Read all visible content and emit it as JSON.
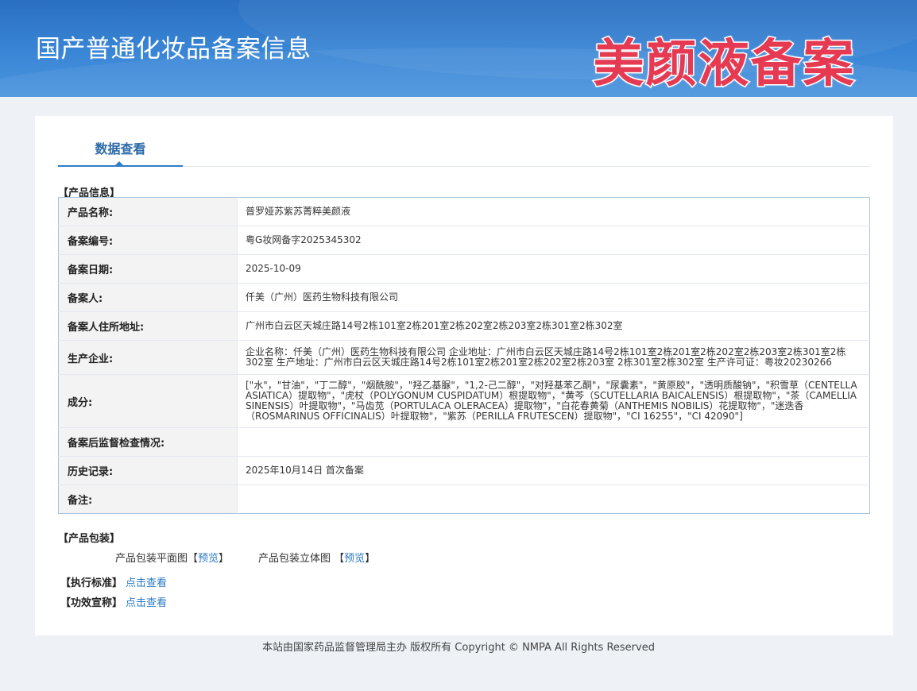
{
  "header": {
    "title": "国产普通化妆品备案信息",
    "overlay_text": "美颜液备案"
  },
  "tabs": [
    {
      "label": "数据查看",
      "active": true
    }
  ],
  "product_info": {
    "section_label": "【产品信息】",
    "rows": [
      {
        "label": "产品名称:",
        "value": "普罗娅苏紫苏菁粹美颜液"
      },
      {
        "label": "备案编号:",
        "value": "粤G妆网备字2025345302"
      },
      {
        "label": "备案日期:",
        "value": "2025-10-09"
      },
      {
        "label": "备案人:",
        "value": "仟美（广州）医药生物科技有限公司"
      },
      {
        "label": "备案人住所地址:",
        "value": "广州市白云区天城庄路14号2栋101室2栋201室2栋202室2栋203室2栋301室2栋302室"
      },
      {
        "label": "生产企业:",
        "value": "企业名称：仟美（广州）医药生物科技有限公司 企业地址：广州市白云区天城庄路14号2栋101室2栋201室2栋202室2栋203室2栋301室2栋302室 生产地址：广州市白云区天城庄路14号2栋101室2栋201室2栋202室2栋203室 2栋301室2栋302室 生产许可证：粤妆20230266"
      },
      {
        "label": "成分:",
        "value": "[\"水\"，\"甘油\"，\"丁二醇\"，\"烟酰胺\"，\"羟乙基脲\"，\"1,2-己二醇\"，\"对羟基苯乙酮\"，\"尿囊素\"，\"黄原胶\"，\"透明质酸钠\"，\"积雪草（CENTELLA ASIATICA）提取物\"，\"虎杖（POLYGONUM CUSPIDATUM）根提取物\"，\"黄芩（SCUTELLARIA BAICALENSIS）根提取物\"，\"茶（CAMELLIA SINENSIS）叶提取物\"，\"马齿苋（PORTULACA OLERACEA）提取物\"，\"白花春黄菊（ANTHEMIS NOBILIS）花提取物\"，\"迷迭香（ROSMARINUS OFFICINALIS）叶提取物\"，\"紫苏（PERILLA FRUTESCEN）提取物\"，\"CI 16255\"，\"CI 42090\"]"
      },
      {
        "label": "备案后监督检查情况:",
        "value": ""
      },
      {
        "label": "历史记录:",
        "value": "2025年10月14日 首次备案"
      },
      {
        "label": "备注:",
        "value": ""
      }
    ]
  },
  "packaging": {
    "section_label": "【产品包装】",
    "flat_label": "产品包装平面图",
    "flat_link": "预览",
    "solid_label": "产品包装立体图",
    "solid_link": "预览",
    "bracket_open": "【",
    "bracket_close": "】"
  },
  "standard": {
    "label": "【执行标准】",
    "link": "点击查看"
  },
  "efficacy": {
    "label": "【功效宣称】",
    "link": "点击查看"
  },
  "footer": {
    "text": "本站由国家药品监督管理局主办 版权所有 Copyright © NMPA All Rights Reserved"
  }
}
